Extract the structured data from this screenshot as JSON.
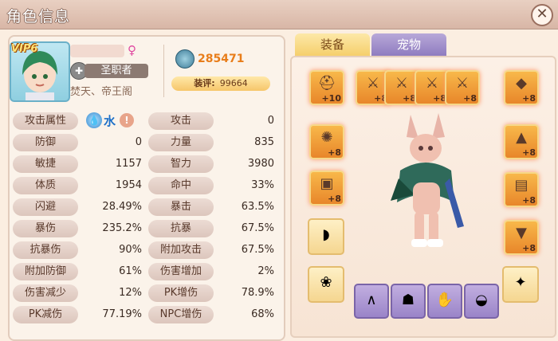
{
  "window": {
    "title": "角色信息",
    "close": "✕"
  },
  "profile": {
    "vip": "VIP6",
    "gender_symbol": "♀",
    "class_name": "圣职者",
    "server": "焚天、帝王阁",
    "power": "285471",
    "score_label": "装评:",
    "score_value": "99664"
  },
  "attribute_row": {
    "label": "攻击属性",
    "element": "水",
    "element_icon": "water-drop",
    "warn": "!"
  },
  "stats_left": [
    {
      "label": "防御",
      "value": "0"
    },
    {
      "label": "敏捷",
      "value": "1157"
    },
    {
      "label": "体质",
      "value": "1954"
    },
    {
      "label": "闪避",
      "value": "28.49%"
    },
    {
      "label": "暴伤",
      "value": "235.2%"
    },
    {
      "label": "抗暴伤",
      "value": "90%"
    },
    {
      "label": "附加防御",
      "value": "61%"
    },
    {
      "label": "伤害减少",
      "value": "12%"
    },
    {
      "label": "PK减伤",
      "value": "77.19%"
    }
  ],
  "stats_right": [
    {
      "label": "攻击",
      "value": "0"
    },
    {
      "label": "力量",
      "value": "835"
    },
    {
      "label": "智力",
      "value": "3980"
    },
    {
      "label": "命中",
      "value": "33%"
    },
    {
      "label": "暴击",
      "value": "63.5%"
    },
    {
      "label": "抗暴",
      "value": "67.5%"
    },
    {
      "label": "附加攻击",
      "value": "67.5%"
    },
    {
      "label": "伤害增加",
      "value": "2%"
    },
    {
      "label": "PK增伤",
      "value": "78.9%"
    },
    {
      "label": "NPC增伤",
      "value": "68%"
    }
  ],
  "tabs": {
    "equip": "装备",
    "pet": "宠物"
  },
  "equipment_top": [
    {
      "name": "slot-helmet",
      "plus": "+10",
      "icon": "helmet"
    },
    {
      "name": "slot-weapon-1",
      "plus": "+8",
      "icon": "sword"
    },
    {
      "name": "slot-weapon-2",
      "plus": "+8",
      "icon": "sword"
    },
    {
      "name": "slot-weapon-3",
      "plus": "+8",
      "icon": "sword"
    },
    {
      "name": "slot-weapon-4",
      "plus": "+8",
      "icon": "sword"
    },
    {
      "name": "slot-gem",
      "plus": "+8",
      "icon": "gem"
    }
  ],
  "equipment_left": [
    {
      "name": "slot-shield",
      "plus": "+8",
      "icon": "shield"
    },
    {
      "name": "slot-chest",
      "plus": "+8",
      "icon": "chest"
    }
  ],
  "equipment_right": [
    {
      "name": "slot-armor",
      "plus": "+8",
      "icon": "armor"
    },
    {
      "name": "slot-belt",
      "plus": "+8",
      "icon": "belt"
    },
    {
      "name": "slot-boots",
      "plus": "+8",
      "icon": "boots"
    }
  ],
  "equipment_extra": [
    {
      "name": "slot-cloak",
      "icon": "cloak"
    },
    {
      "name": "slot-necklace",
      "icon": "necklace"
    },
    {
      "name": "slot-ornament",
      "icon": "ornament"
    }
  ],
  "pet_parts": [
    {
      "name": "pet-part-ears",
      "icon": "ears"
    },
    {
      "name": "pet-part-body",
      "icon": "body"
    },
    {
      "name": "pet-part-gloves",
      "icon": "gloves"
    },
    {
      "name": "pet-part-feet",
      "icon": "feet"
    }
  ],
  "colors": {
    "power": "#e87d1a",
    "element": "#1e70c8",
    "tab_pet": "#8f7cc0",
    "tab_equip": "#f5cf6c"
  }
}
